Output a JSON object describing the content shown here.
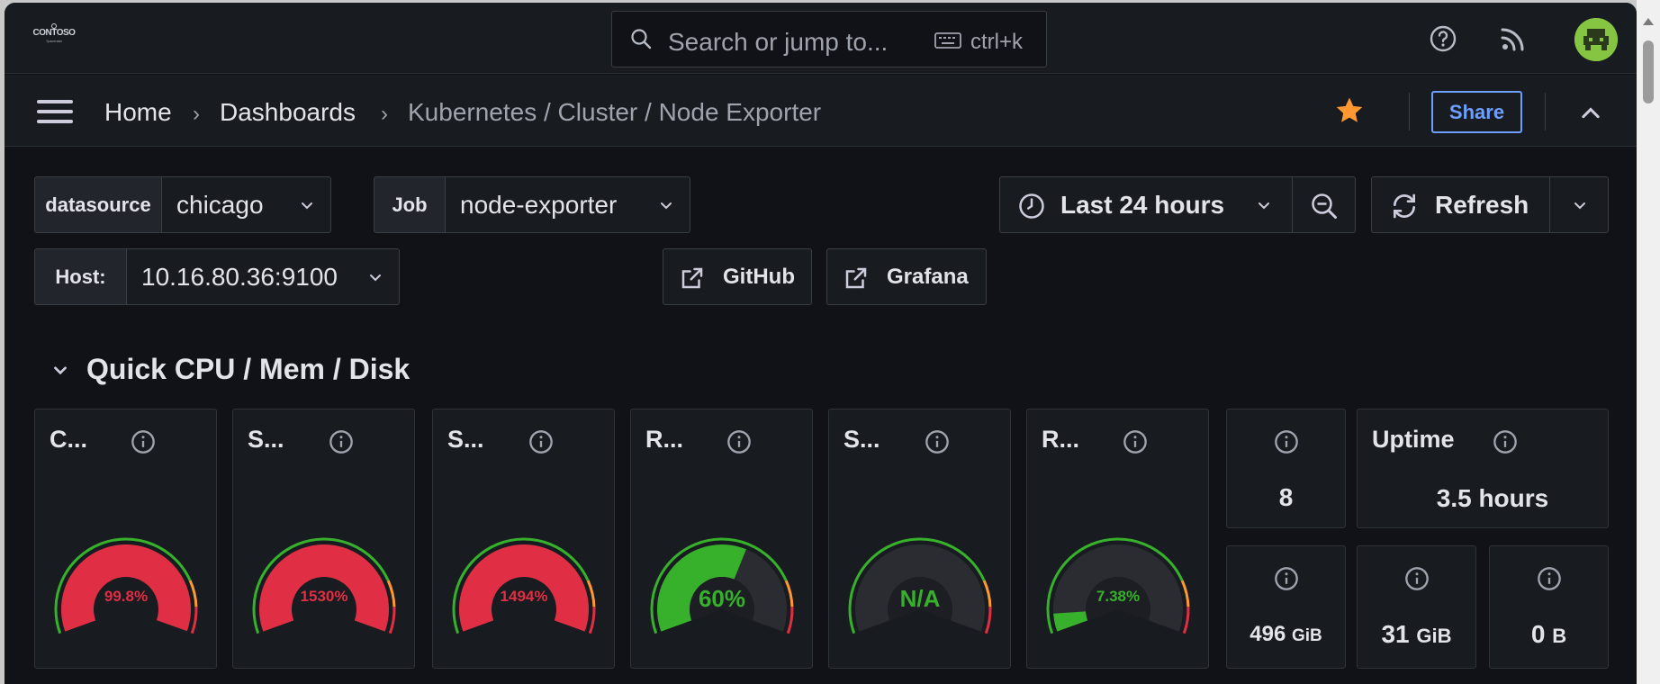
{
  "topbar": {
    "logo_text": "CONTOSO",
    "logo_subtext": "Spacemaker",
    "search_placeholder": "Search or jump to...",
    "search_shortcut": "ctrl+k",
    "icons": [
      "help-icon",
      "rss-icon",
      "avatar"
    ]
  },
  "navbar": {
    "breadcrumbs": [
      "Home",
      "Dashboards",
      "Kubernetes / Cluster / Node Exporter"
    ],
    "share_label": "Share",
    "starred": true
  },
  "variables": {
    "datasource": {
      "label": "datasource",
      "value": "chicago"
    },
    "job": {
      "label": "Job",
      "value": "node-exporter"
    },
    "host": {
      "label": "Host:",
      "value": "10.16.80.36:9100"
    }
  },
  "time": {
    "range_label": "Last 24 hours",
    "refresh_label": "Refresh"
  },
  "links": {
    "github": "GitHub",
    "grafana": "Grafana"
  },
  "row": {
    "title": "Quick CPU / Mem / Disk"
  },
  "gauges": [
    {
      "title": "C...",
      "value_text": "99.8%",
      "fill": 0.998,
      "value_color": "#e02f44"
    },
    {
      "title": "S...",
      "value_text": "1530%",
      "fill": 1.0,
      "value_color": "#e02f44"
    },
    {
      "title": "S...",
      "value_text": "1494%",
      "fill": 1.0,
      "value_color": "#e02f44"
    },
    {
      "title": "R...",
      "value_text": "60%",
      "fill": 0.6,
      "value_color": "#37b02c"
    },
    {
      "title": "S...",
      "value_text": "N/A",
      "fill": 0,
      "value_color": "#37b02c"
    },
    {
      "title": "R...",
      "value_text": "7.38%",
      "fill": 0.0738,
      "value_color": "#37b02c"
    }
  ],
  "stats": {
    "cores": {
      "value": "8"
    },
    "uptime": {
      "title": "Uptime",
      "value": "3.5 hours"
    },
    "root_fs": {
      "value": "496",
      "unit": "GiB"
    },
    "ram_total": {
      "value": "31",
      "unit": "GiB"
    },
    "swap_total": {
      "value": "0",
      "unit": "B"
    }
  },
  "colors": {
    "red": "#e02f44",
    "green": "#37b02c",
    "orange": "#ff9830",
    "accent": "#6e9fff"
  }
}
